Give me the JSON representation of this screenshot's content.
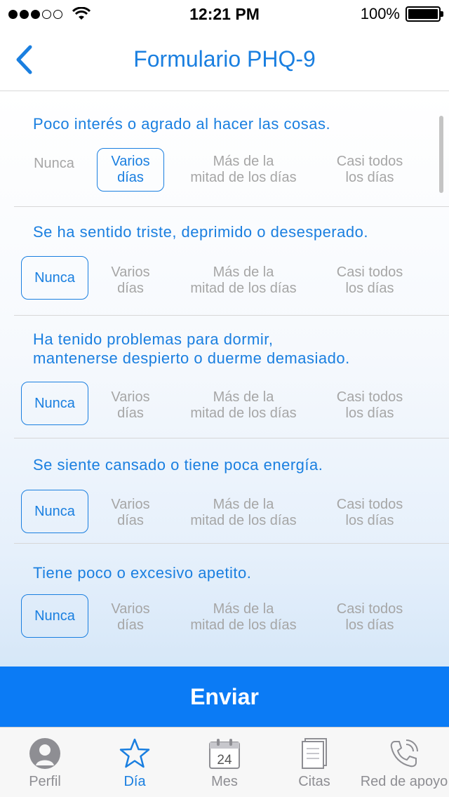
{
  "status_bar": {
    "time": "12:21 PM",
    "battery": "100%",
    "signal_filled": 3,
    "signal_total": 5
  },
  "nav": {
    "title": "Formulario PHQ-9"
  },
  "questions": [
    {
      "text": "Poco interés o agrado al hacer las cosas.",
      "options": [
        "Nunca",
        "Varios\ndías",
        "Más de la\nmitad de los días",
        "Casi todos\nlos días"
      ],
      "selected": 1
    },
    {
      "text": "Se ha sentido triste, deprimido o desesperado.",
      "options": [
        "Nunca",
        "Varios\ndías",
        "Más de la\nmitad de los días",
        "Casi todos\nlos días"
      ],
      "selected": 0
    },
    {
      "text": "Ha tenido problemas para dormir,\nmantenerse despierto o duerme demasiado.",
      "options": [
        "Nunca",
        "Varios\ndías",
        "Más de la\nmitad de los días",
        "Casi todos\nlos días"
      ],
      "selected": 0
    },
    {
      "text": "Se siente cansado o tiene poca energía.",
      "options": [
        "Nunca",
        "Varios\ndías",
        "Más de la\nmitad de los días",
        "Casi todos\nlos días"
      ],
      "selected": 0
    },
    {
      "text": "Tiene poco o excesivo apetito.",
      "options": [
        "Nunca",
        "Varios\ndías",
        "Más de la\nmitad de los días",
        "Casi todos\nlos días"
      ],
      "selected": 0
    }
  ],
  "submit_label": "Enviar",
  "calendar_day": "24",
  "tabs": [
    {
      "label": "Perfil",
      "icon": "profile-icon",
      "active": false
    },
    {
      "label": "Día",
      "icon": "star-icon",
      "active": true
    },
    {
      "label": "Mes",
      "icon": "calendar-icon",
      "active": false
    },
    {
      "label": "Citas",
      "icon": "documents-icon",
      "active": false
    },
    {
      "label": "Red de apoyo",
      "icon": "phone-icon",
      "active": false
    }
  ],
  "colors": {
    "accent": "#1a7fe0",
    "button": "#0b7bf5",
    "inactive": "#a6a6a6"
  }
}
